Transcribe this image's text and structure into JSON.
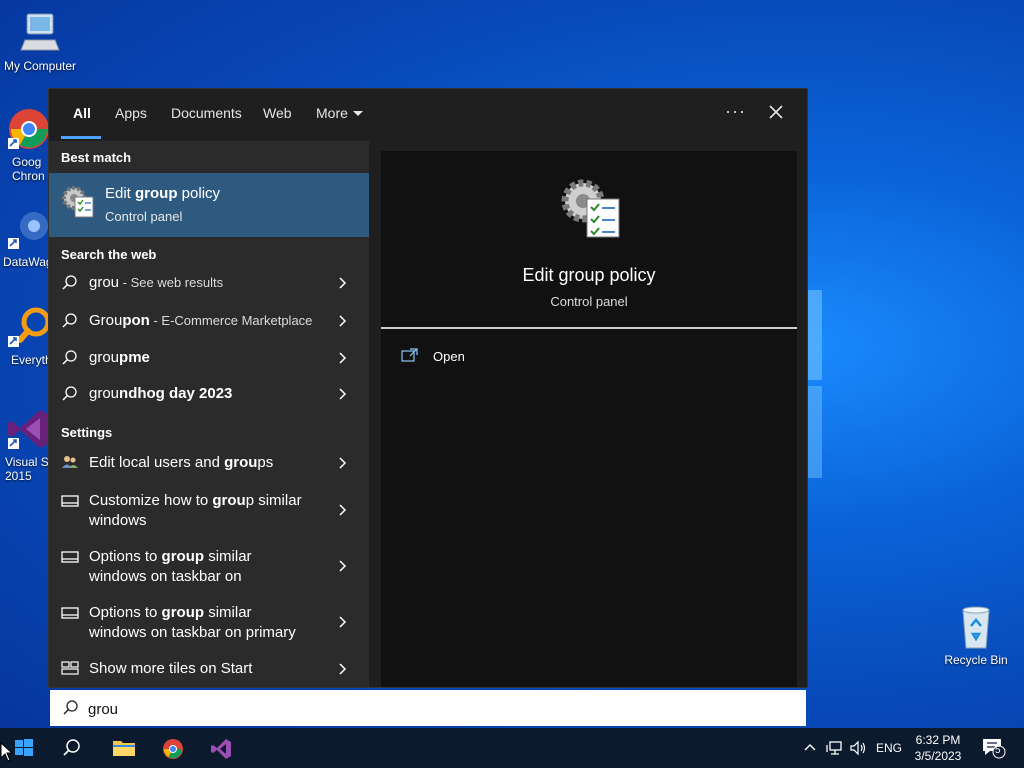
{
  "desktop": {
    "icons": [
      {
        "label": "My Computer"
      },
      {
        "label": "Goog\nChron"
      },
      {
        "label": "DataWag"
      },
      {
        "label": "Everyth"
      },
      {
        "label": "Visual St\n2015"
      },
      {
        "label": "Recycle Bin"
      }
    ]
  },
  "search_panel": {
    "tabs": [
      {
        "label": "All",
        "active": true
      },
      {
        "label": "Apps"
      },
      {
        "label": "Documents"
      },
      {
        "label": "Web"
      },
      {
        "label": "More"
      }
    ],
    "options_label": "···",
    "best_match": {
      "header": "Best match",
      "title_prefix": "Edit ",
      "title_bold": "group",
      "title_suffix": " policy",
      "subtitle": "Control panel"
    },
    "web": {
      "header": "Search the web",
      "items": [
        {
          "normal": "grou",
          "bold": "",
          "sub": " - See web results"
        },
        {
          "normal": "Grou",
          "bold": "pon",
          "sub": " - E-Commerce Marketplace"
        },
        {
          "normal": "grou",
          "bold": "pme",
          "sub": ""
        },
        {
          "normal": "grou",
          "bold": "ndhog day 2023",
          "sub": ""
        }
      ]
    },
    "settings": {
      "header": "Settings",
      "items": [
        {
          "pre": "Edit local users and ",
          "bold": "grou",
          "post": "ps",
          "line2": ""
        },
        {
          "pre": "Customize how to ",
          "bold": "grou",
          "post": "p similar",
          "line2": "windows"
        },
        {
          "pre": "Options to ",
          "bold": "group",
          "post": " similar",
          "line2": "windows on taskbar on"
        },
        {
          "pre": "Options to ",
          "bold": "group",
          "post": " similar",
          "line2": "windows on taskbar on primary"
        },
        {
          "pre": "Show more tiles on Start",
          "bold": "",
          "post": "",
          "line2": ""
        }
      ]
    },
    "preview": {
      "title": "Edit group policy",
      "subtitle": "Control panel",
      "actions": [
        {
          "label": "Open"
        }
      ]
    }
  },
  "search_box": {
    "value": "grou"
  },
  "taskbar": {
    "apps": [
      "start-button",
      "search",
      "file-explorer",
      "chrome",
      "visual-studio"
    ],
    "tray": {
      "language": "ENG",
      "time": "6:32 PM",
      "date": "3/5/2023",
      "notifications": "5"
    }
  }
}
